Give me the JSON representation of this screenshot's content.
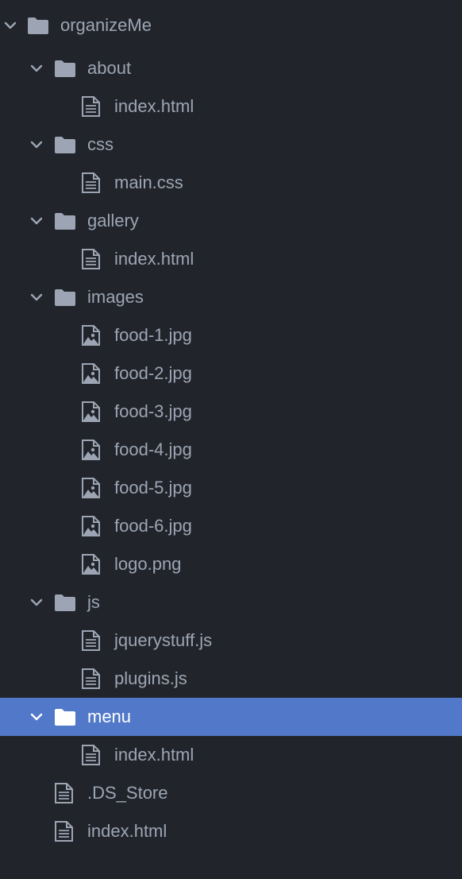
{
  "colors": {
    "background": "#21252b",
    "text": "#9da5b4",
    "selected_background": "#5279c9",
    "selected_text": "#ffffff"
  },
  "tree": {
    "root": {
      "label": "organizeMe",
      "type": "folder",
      "expanded": true
    },
    "items": [
      {
        "label": "about",
        "type": "folder",
        "expanded": true
      },
      {
        "label": "index.html",
        "type": "file"
      },
      {
        "label": "css",
        "type": "folder",
        "expanded": true
      },
      {
        "label": "main.css",
        "type": "file"
      },
      {
        "label": "gallery",
        "type": "folder",
        "expanded": true
      },
      {
        "label": "index.html",
        "type": "file"
      },
      {
        "label": "images",
        "type": "folder",
        "expanded": true
      },
      {
        "label": "food-1.jpg",
        "type": "image"
      },
      {
        "label": "food-2.jpg",
        "type": "image"
      },
      {
        "label": "food-3.jpg",
        "type": "image"
      },
      {
        "label": "food-4.jpg",
        "type": "image"
      },
      {
        "label": "food-5.jpg",
        "type": "image"
      },
      {
        "label": "food-6.jpg",
        "type": "image"
      },
      {
        "label": "logo.png",
        "type": "image"
      },
      {
        "label": "js",
        "type": "folder",
        "expanded": true
      },
      {
        "label": "jquerystuff.js",
        "type": "file"
      },
      {
        "label": "plugins.js",
        "type": "file"
      },
      {
        "label": "menu",
        "type": "folder",
        "expanded": true,
        "selected": true
      },
      {
        "label": "index.html",
        "type": "file"
      },
      {
        "label": ".DS_Store",
        "type": "file"
      },
      {
        "label": "index.html",
        "type": "file"
      }
    ]
  }
}
